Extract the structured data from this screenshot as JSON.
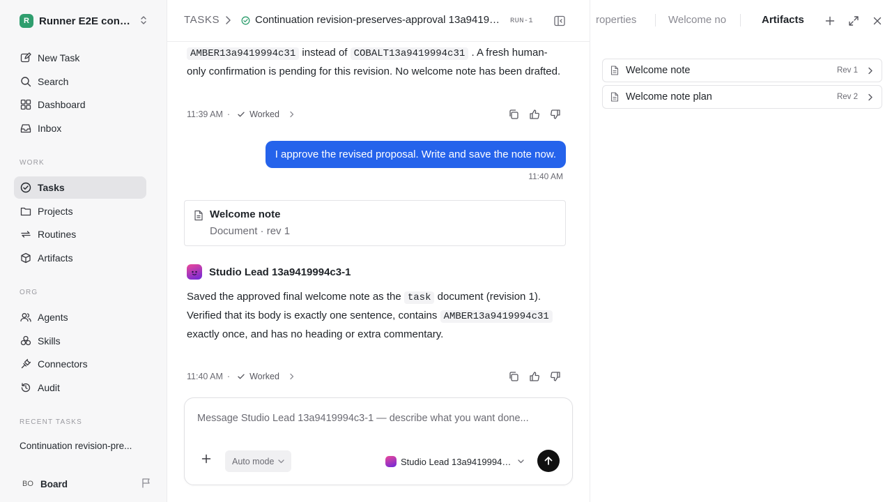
{
  "workspace": {
    "logo_letter": "R",
    "name": "Runner E2E conti..."
  },
  "nav": {
    "main": [
      {
        "label": "New Task",
        "icon": "pencil-square-icon"
      },
      {
        "label": "Search",
        "icon": "search-icon"
      },
      {
        "label": "Dashboard",
        "icon": "dashboard-icon"
      },
      {
        "label": "Inbox",
        "icon": "inbox-icon"
      }
    ],
    "work_label": "WORK",
    "work": [
      {
        "label": "Tasks",
        "icon": "check-circle-icon",
        "active": true
      },
      {
        "label": "Projects",
        "icon": "folder-icon"
      },
      {
        "label": "Routines",
        "icon": "repeat-icon"
      },
      {
        "label": "Artifacts",
        "icon": "box-icon"
      }
    ],
    "org_label": "ORG",
    "org": [
      {
        "label": "Agents",
        "icon": "users-icon"
      },
      {
        "label": "Skills",
        "icon": "skills-icon"
      },
      {
        "label": "Connectors",
        "icon": "plug-icon"
      },
      {
        "label": "Audit",
        "icon": "history-icon"
      }
    ],
    "recent_label": "RECENT TASKS",
    "recent": [
      {
        "label": "Continuation revision-pre..."
      }
    ]
  },
  "user": {
    "initials": "BO",
    "name": "Board"
  },
  "header": {
    "root": "TASKS",
    "title": "Continuation revision-preserves-approval 13a94199...",
    "run_badge": "RUN-1"
  },
  "messages": {
    "first": {
      "code_a": "AMBER13a9419994c31",
      "text_a": "instead of",
      "code_b": "COBALT13a9419994c31",
      "text_b": ". A fresh human-only confirmation is pending for this revision. No welcome note has been drafted.",
      "time": "11:39 AM",
      "status": "Worked"
    },
    "user": {
      "text": "I approve the revised proposal. Write and save the note now.",
      "time": "11:40 AM"
    },
    "doc_card": {
      "title": "Welcome note",
      "subtitle": "Document · rev 1"
    },
    "agent": {
      "name": "Studio Lead 13a9419994c3-1",
      "text_a": "Saved the approved final welcome note as the",
      "code_a": "task",
      "text_b": "document (revision 1). Verified that its body is exactly one sentence, contains",
      "code_b": "AMBER13a9419994c31",
      "text_c": "exactly once, and has no heading or extra commentary.",
      "time": "11:40 AM",
      "status": "Worked"
    }
  },
  "composer": {
    "placeholder": "Message Studio Lead 13a9419994c3-1 — describe what you want done...",
    "value": "",
    "mode": "Auto mode",
    "agent": "Studio Lead 13a9419994c..."
  },
  "right_panel": {
    "tabs": [
      {
        "label": "roperties"
      },
      {
        "label": "Welcome no"
      },
      {
        "label": "Artifacts",
        "active": true
      }
    ],
    "artifacts": [
      {
        "name": "Welcome note",
        "rev": "Rev 1"
      },
      {
        "name": "Welcome note plan",
        "rev": "Rev 2"
      }
    ]
  },
  "colors": {
    "accent": "#2563eb",
    "status_green": "#2f9e6e",
    "active_nav": "#e4e4e7"
  }
}
